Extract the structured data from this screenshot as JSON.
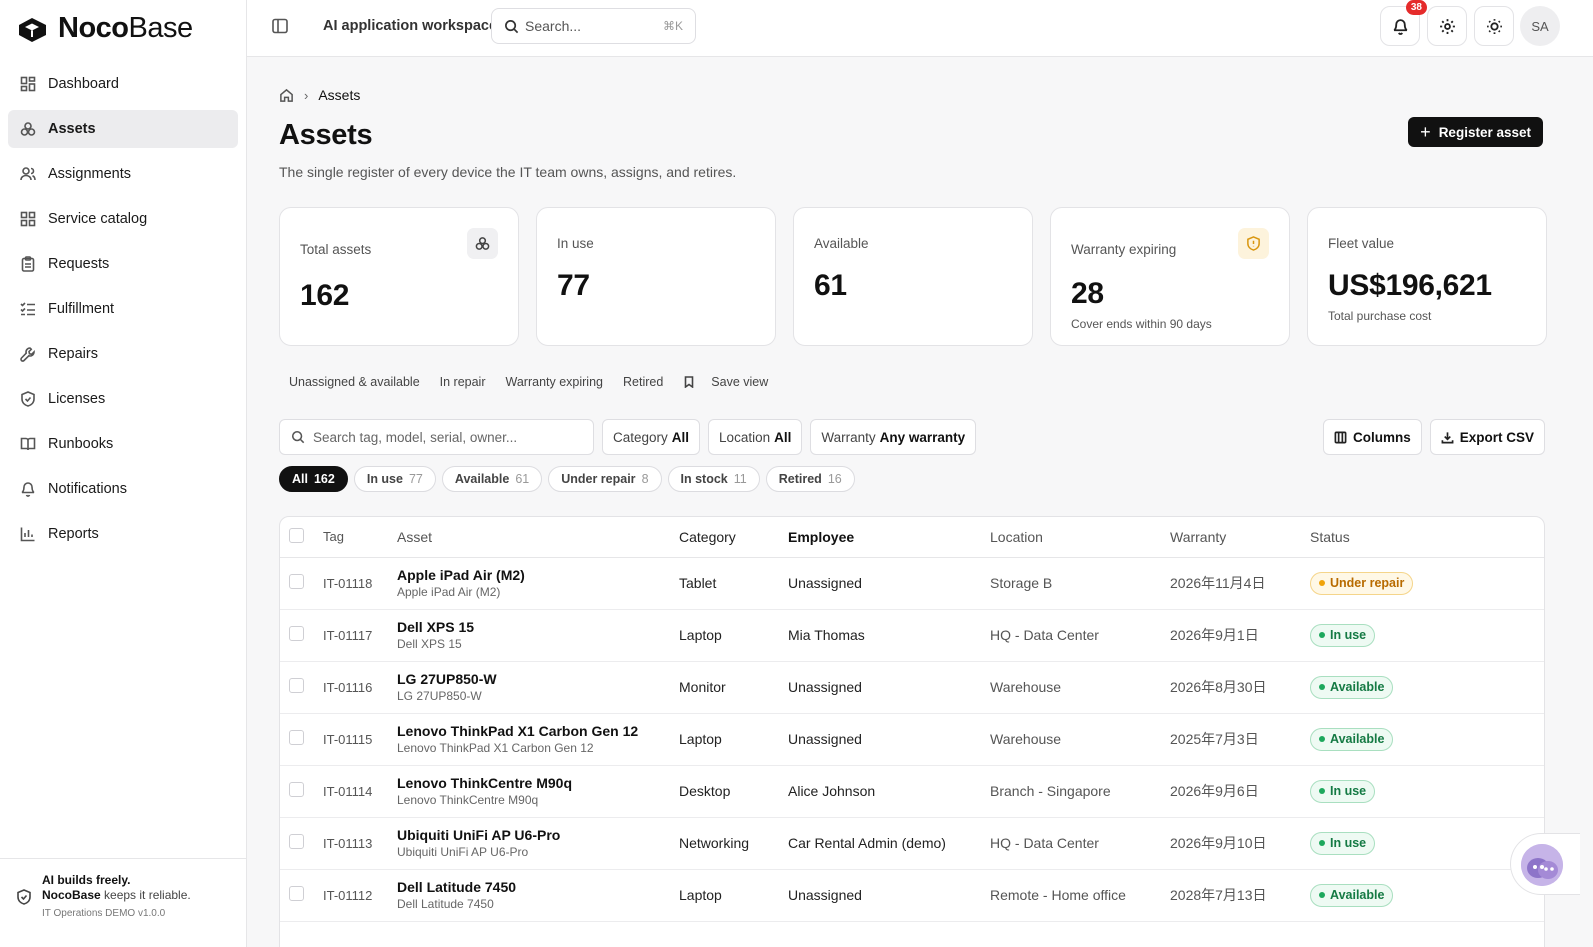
{
  "brand": {
    "bold": "Noco",
    "light": "Base"
  },
  "sidebar": {
    "items": [
      {
        "label": "Dashboard",
        "icon": "dashboard-icon",
        "active": false
      },
      {
        "label": "Assets",
        "icon": "assets-icon",
        "active": true
      },
      {
        "label": "Assignments",
        "icon": "users-icon",
        "active": false
      },
      {
        "label": "Service catalog",
        "icon": "grid-icon",
        "active": false
      },
      {
        "label": "Requests",
        "icon": "clipboard-icon",
        "active": false
      },
      {
        "label": "Fulfillment",
        "icon": "list-check-icon",
        "active": false
      },
      {
        "label": "Repairs",
        "icon": "wrench-icon",
        "active": false
      },
      {
        "label": "Licenses",
        "icon": "shield-check-icon",
        "active": false
      },
      {
        "label": "Runbooks",
        "icon": "book-icon",
        "active": false
      },
      {
        "label": "Notifications",
        "icon": "bell-icon",
        "active": false
      },
      {
        "label": "Reports",
        "icon": "bar-chart-icon",
        "active": false
      }
    ],
    "footer": {
      "line1": "AI builds freely.",
      "line2_bold": "NocoBase",
      "line2_rest": " keeps it reliable.",
      "version": "IT Operations DEMO v1.0.0"
    }
  },
  "topbar": {
    "workspace": "AI application workspace",
    "search_placeholder": "Search...",
    "search_shortcut": "⌘K",
    "notification_count": "38",
    "avatar_initials": "SA"
  },
  "page": {
    "breadcrumb": "Assets",
    "title": "Assets",
    "description": "The single register of every device the IT team owns, assigns, and retires.",
    "register_button": "Register asset"
  },
  "stats": [
    {
      "label": "Total assets",
      "value": "162",
      "sub": ""
    },
    {
      "label": "In use",
      "value": "77",
      "sub": ""
    },
    {
      "label": "Available",
      "value": "61",
      "sub": ""
    },
    {
      "label": "Warranty expiring",
      "value": "28",
      "sub": "Cover ends within 90 days"
    },
    {
      "label": "Fleet value",
      "value": "US$196,621",
      "sub": "Total purchase cost"
    }
  ],
  "saved_views": [
    "Unassigned & available",
    "In repair",
    "Warranty expiring",
    "Retired"
  ],
  "save_view_label": "Save view",
  "filters": {
    "search_placeholder": "Search tag, model, serial, owner...",
    "category": {
      "label": "Category",
      "value": "All"
    },
    "location": {
      "label": "Location",
      "value": "All"
    },
    "warranty": {
      "label": "Warranty",
      "value": "Any warranty"
    },
    "columns_button": "Columns",
    "export_button": "Export CSV"
  },
  "status_chips": [
    {
      "label": "All",
      "count": "162"
    },
    {
      "label": "In use",
      "count": "77"
    },
    {
      "label": "Available",
      "count": "61"
    },
    {
      "label": "Under repair",
      "count": "8"
    },
    {
      "label": "In stock",
      "count": "11"
    },
    {
      "label": "Retired",
      "count": "16"
    }
  ],
  "table": {
    "columns": [
      "Tag",
      "Asset",
      "Category",
      "Employee",
      "Location",
      "Warranty",
      "Status"
    ],
    "rows": [
      {
        "tag": "IT-01118",
        "asset": "Apple iPad Air (M2)",
        "model": "Apple iPad Air (M2)",
        "category": "Tablet",
        "employee": "Unassigned",
        "location": "Storage B",
        "warranty": "2026年11月4日",
        "status": "Under repair"
      },
      {
        "tag": "IT-01117",
        "asset": "Dell XPS 15",
        "model": "Dell XPS 15",
        "category": "Laptop",
        "employee": "Mia Thomas",
        "location": "HQ - Data Center",
        "warranty": "2026年9月1日",
        "status": "In use"
      },
      {
        "tag": "IT-01116",
        "asset": "LG 27UP850-W",
        "model": "LG 27UP850-W",
        "category": "Monitor",
        "employee": "Unassigned",
        "location": "Warehouse",
        "warranty": "2026年8月30日",
        "status": "Available"
      },
      {
        "tag": "IT-01115",
        "asset": "Lenovo ThinkPad X1 Carbon Gen 12",
        "model": "Lenovo ThinkPad X1 Carbon Gen 12",
        "category": "Laptop",
        "employee": "Unassigned",
        "location": "Warehouse",
        "warranty": "2025年7月3日",
        "status": "Available"
      },
      {
        "tag": "IT-01114",
        "asset": "Lenovo ThinkCentre M90q",
        "model": "Lenovo ThinkCentre M90q",
        "category": "Desktop",
        "employee": "Alice Johnson",
        "location": "Branch - Singapore",
        "warranty": "2026年9月6日",
        "status": "In use"
      },
      {
        "tag": "IT-01113",
        "asset": "Ubiquiti UniFi AP U6-Pro",
        "model": "Ubiquiti UniFi AP U6-Pro",
        "category": "Networking",
        "employee": "Car Rental Admin (demo)",
        "location": "HQ - Data Center",
        "warranty": "2026年9月10日",
        "status": "In use"
      },
      {
        "tag": "IT-01112",
        "asset": "Dell Latitude 7450",
        "model": "Dell Latitude 7450",
        "category": "Laptop",
        "employee": "Unassigned",
        "location": "Remote - Home office",
        "warranty": "2028年7月13日",
        "status": "Available"
      }
    ]
  },
  "colors": {
    "accent": "#111111",
    "danger": "#e52b2b",
    "warning": "#f0a30a",
    "success": "#1ea85d"
  }
}
